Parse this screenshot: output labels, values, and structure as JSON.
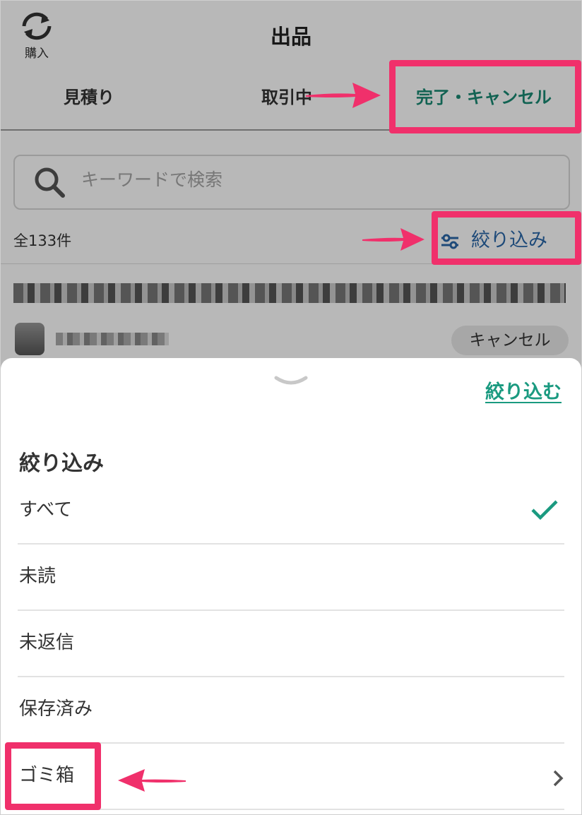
{
  "header": {
    "swap_label": "購入",
    "title": "出品"
  },
  "tabs": [
    {
      "label": "見積り"
    },
    {
      "label": "取引中"
    },
    {
      "label": "完了・キャンセル",
      "active": true
    }
  ],
  "search": {
    "placeholder": "キーワードで検索"
  },
  "list": {
    "count": "全133件",
    "filter_label": "絞り込み",
    "item_status": "キャンセル"
  },
  "sheet": {
    "apply_label": "絞り込む",
    "title": "絞り込み",
    "options": [
      {
        "label": "すべて",
        "selected": true
      },
      {
        "label": "未読"
      },
      {
        "label": "未返信"
      },
      {
        "label": "保存済み"
      },
      {
        "label": "ゴミ箱",
        "has_submenu": true
      }
    ]
  },
  "colors": {
    "accent": "#1a8a73",
    "link": "#2a67a8",
    "annotation": "#f0306b"
  },
  "icons": {
    "swap": "swap-arrows-icon",
    "search": "search-icon",
    "filter": "sliders-icon",
    "handle": "chevron-down-icon",
    "check": "check-icon",
    "submenu": "chevron-right-icon"
  }
}
